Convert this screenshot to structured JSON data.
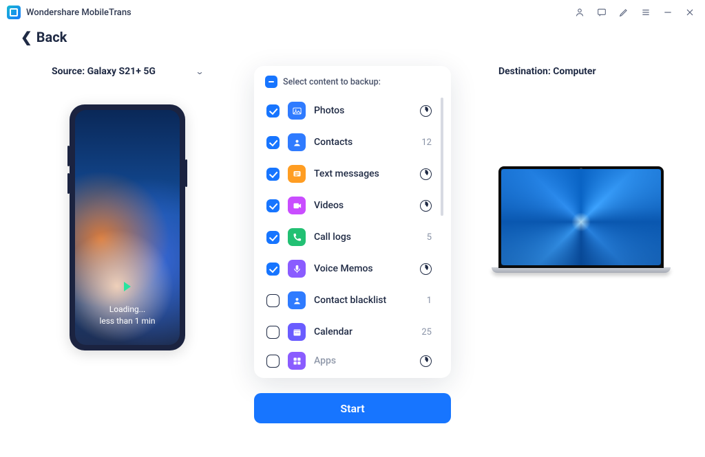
{
  "app": {
    "title": "Wondershare MobileTrans"
  },
  "nav": {
    "back": "Back"
  },
  "source": {
    "prefix": "Source: ",
    "device": "Galaxy S21+ 5G"
  },
  "destination": {
    "prefix": "Destination: ",
    "device": "Computer"
  },
  "phone": {
    "loading_line1": "Loading...",
    "loading_line2": "less than 1 min"
  },
  "panel": {
    "title": "Select content to backup:"
  },
  "items": [
    {
      "label": "Photos",
      "checked": true,
      "meta_type": "spinner",
      "meta": "",
      "icon": "photos",
      "color": "#2f7bff"
    },
    {
      "label": "Contacts",
      "checked": true,
      "meta_type": "count",
      "meta": "12",
      "icon": "contacts",
      "color": "#2f7bff"
    },
    {
      "label": "Text messages",
      "checked": true,
      "meta_type": "spinner",
      "meta": "",
      "icon": "messages",
      "color": "#ff9d22"
    },
    {
      "label": "Videos",
      "checked": true,
      "meta_type": "spinner",
      "meta": "",
      "icon": "videos",
      "color": "#c94dff"
    },
    {
      "label": "Call logs",
      "checked": true,
      "meta_type": "count",
      "meta": "5",
      "icon": "calllogs",
      "color": "#22c073"
    },
    {
      "label": "Voice Memos",
      "checked": true,
      "meta_type": "spinner",
      "meta": "",
      "icon": "voice",
      "color": "#8a5cff"
    },
    {
      "label": "Contact blacklist",
      "checked": false,
      "meta_type": "count",
      "meta": "1",
      "icon": "blacklist",
      "color": "#2f7bff"
    },
    {
      "label": "Calendar",
      "checked": false,
      "meta_type": "count",
      "meta": "25",
      "icon": "calendar",
      "color": "#6a5cff"
    },
    {
      "label": "Apps",
      "checked": false,
      "meta_type": "spinner",
      "meta": "",
      "icon": "apps",
      "color": "#8a5cff"
    }
  ],
  "actions": {
    "start": "Start"
  }
}
